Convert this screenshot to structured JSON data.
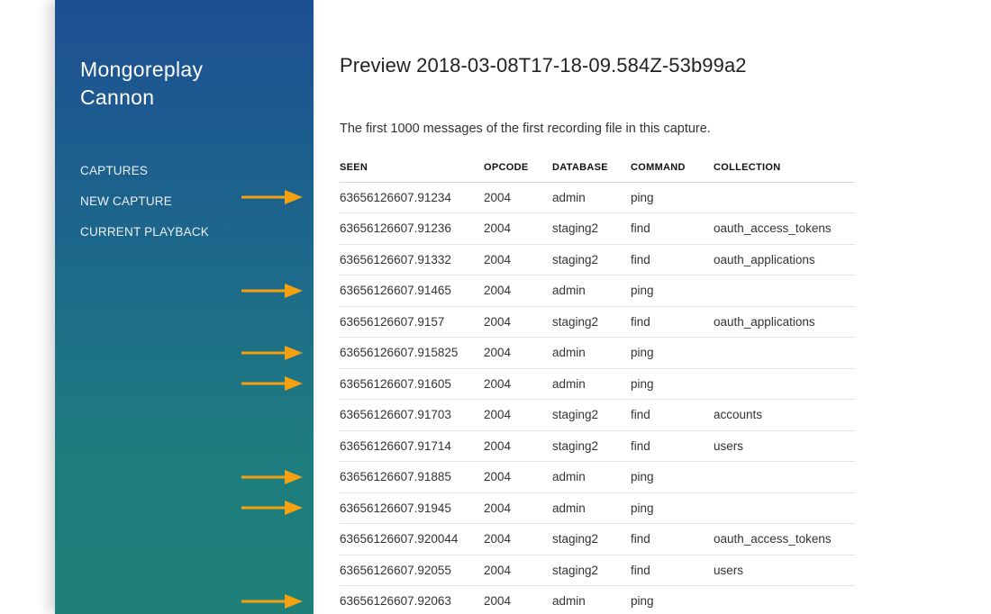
{
  "sidebar": {
    "title_line1": "Mongoreplay",
    "title_line2": "Cannon",
    "nav": [
      {
        "label": "CAPTURES"
      },
      {
        "label": "NEW CAPTURE"
      },
      {
        "label": "CURRENT PLAYBACK"
      }
    ]
  },
  "main": {
    "title": "Preview 2018-03-08T17-18-09.584Z-53b99a2",
    "subtitle": "The first 1000 messages of the first recording file in this capture.",
    "table": {
      "headers": {
        "seen": "SEEN",
        "opcode": "OPCODE",
        "database": "DATABASE",
        "command": "COMMAND",
        "collection": "COLLECTION"
      },
      "rows": [
        {
          "seen": "63656126607.91234",
          "opcode": "2004",
          "database": "admin",
          "command": "ping",
          "collection": ""
        },
        {
          "seen": "63656126607.91236",
          "opcode": "2004",
          "database": "staging2",
          "command": "find",
          "collection": "oauth_access_tokens"
        },
        {
          "seen": "63656126607.91332",
          "opcode": "2004",
          "database": "staging2",
          "command": "find",
          "collection": "oauth_applications"
        },
        {
          "seen": "63656126607.91465",
          "opcode": "2004",
          "database": "admin",
          "command": "ping",
          "collection": ""
        },
        {
          "seen": "63656126607.9157",
          "opcode": "2004",
          "database": "staging2",
          "command": "find",
          "collection": "oauth_applications"
        },
        {
          "seen": "63656126607.915825",
          "opcode": "2004",
          "database": "admin",
          "command": "ping",
          "collection": ""
        },
        {
          "seen": "63656126607.91605",
          "opcode": "2004",
          "database": "admin",
          "command": "ping",
          "collection": ""
        },
        {
          "seen": "63656126607.91703",
          "opcode": "2004",
          "database": "staging2",
          "command": "find",
          "collection": "accounts"
        },
        {
          "seen": "63656126607.91714",
          "opcode": "2004",
          "database": "staging2",
          "command": "find",
          "collection": "users"
        },
        {
          "seen": "63656126607.91885",
          "opcode": "2004",
          "database": "admin",
          "command": "ping",
          "collection": ""
        },
        {
          "seen": "63656126607.91945",
          "opcode": "2004",
          "database": "admin",
          "command": "ping",
          "collection": ""
        },
        {
          "seen": "63656126607.920044",
          "opcode": "2004",
          "database": "staging2",
          "command": "find",
          "collection": "oauth_access_tokens"
        },
        {
          "seen": "63656126607.92055",
          "opcode": "2004",
          "database": "staging2",
          "command": "find",
          "collection": "users"
        },
        {
          "seen": "63656126607.92063",
          "opcode": "2004",
          "database": "admin",
          "command": "ping",
          "collection": ""
        }
      ]
    }
  },
  "annotations": {
    "arrow_icon": "right-arrow-icon",
    "arrow_color": "#f5a00f",
    "arrow_rows": [
      0,
      3,
      5,
      6,
      9,
      10,
      13
    ]
  },
  "colors": {
    "sidebar_top": "#1d4f93",
    "sidebar_bottom": "#1f8079",
    "text": "#222222"
  }
}
